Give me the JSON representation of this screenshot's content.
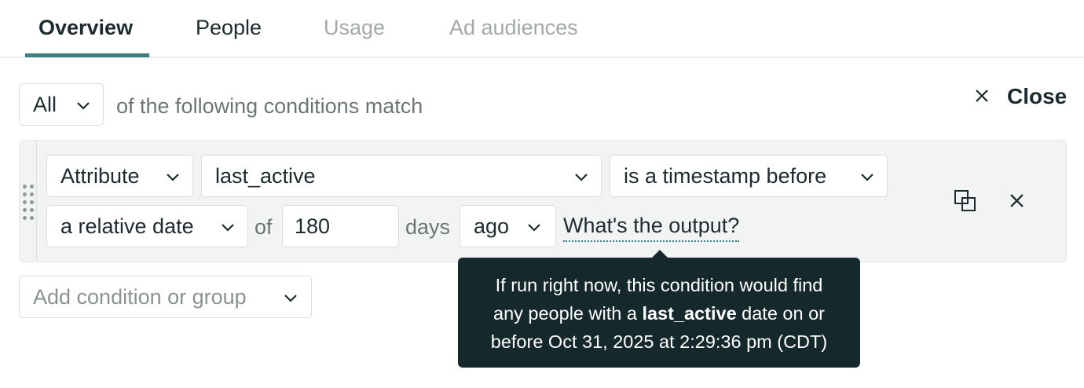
{
  "tabs": [
    {
      "label": "Overview",
      "state": "active"
    },
    {
      "label": "People",
      "state": "normal"
    },
    {
      "label": "Usage",
      "state": "disabled"
    },
    {
      "label": "Ad audiences",
      "state": "disabled"
    }
  ],
  "match": {
    "select_value": "All",
    "suffix": "of the following conditions match"
  },
  "close": {
    "label": "Close",
    "icon": "close-icon"
  },
  "condition": {
    "type_select": "Attribute",
    "attribute_select": "last_active",
    "operator_select": "is a timestamp before",
    "date_mode_select": "a relative date",
    "of_label": "of",
    "amount_value": "180",
    "unit_label": "days",
    "direction_select": "ago",
    "output_link": "What's the output?",
    "duplicate_icon": "duplicate-icon",
    "remove_icon": "close-icon"
  },
  "tooltip": {
    "line1": "If run right now, this condition would find",
    "line2_pre": "any people with a ",
    "line2_bold": "last_active",
    "line2_post": " date on or",
    "line3": "before Oct 31, 2025 at 2:29:36 pm (CDT)"
  },
  "add_condition": {
    "placeholder": "Add condition or group"
  },
  "colors": {
    "accent": "#3e7d80",
    "tooltip_bg": "#15292c",
    "panel_bg": "#f2f4f4",
    "text": "#1d2a2e",
    "muted": "#6d7577",
    "disabled": "#a2a8aa"
  }
}
